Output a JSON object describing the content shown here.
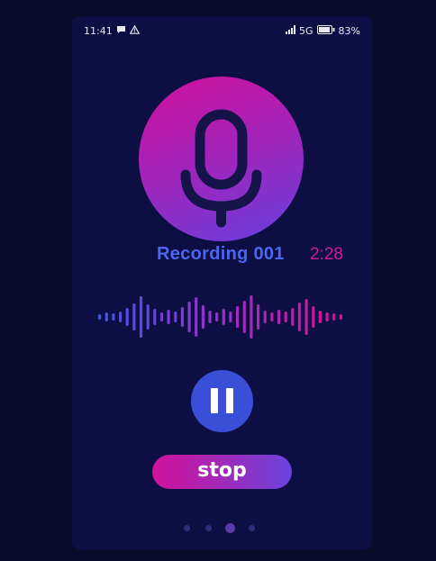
{
  "status_bar": {
    "time": "11:41",
    "network": "5G",
    "battery": "83%"
  },
  "recording": {
    "title": "Recording 001",
    "duration": "2:28"
  },
  "controls": {
    "stop_label": "stop"
  },
  "pagination": {
    "count": 4,
    "active_index": 2
  },
  "icons": {
    "microphone": "microphone-icon",
    "pause": "pause-icon",
    "message": "message-icon",
    "warning": "warning-icon",
    "signal": "signal-icon",
    "battery": "battery-icon"
  },
  "colors": {
    "background": "#0a0b2a",
    "panel": "#0d0e44",
    "accent_blue": "#3a4fd8",
    "accent_pink": "#d2109c",
    "title_blue": "#4c66ee",
    "time_pink": "#cf1c92"
  }
}
